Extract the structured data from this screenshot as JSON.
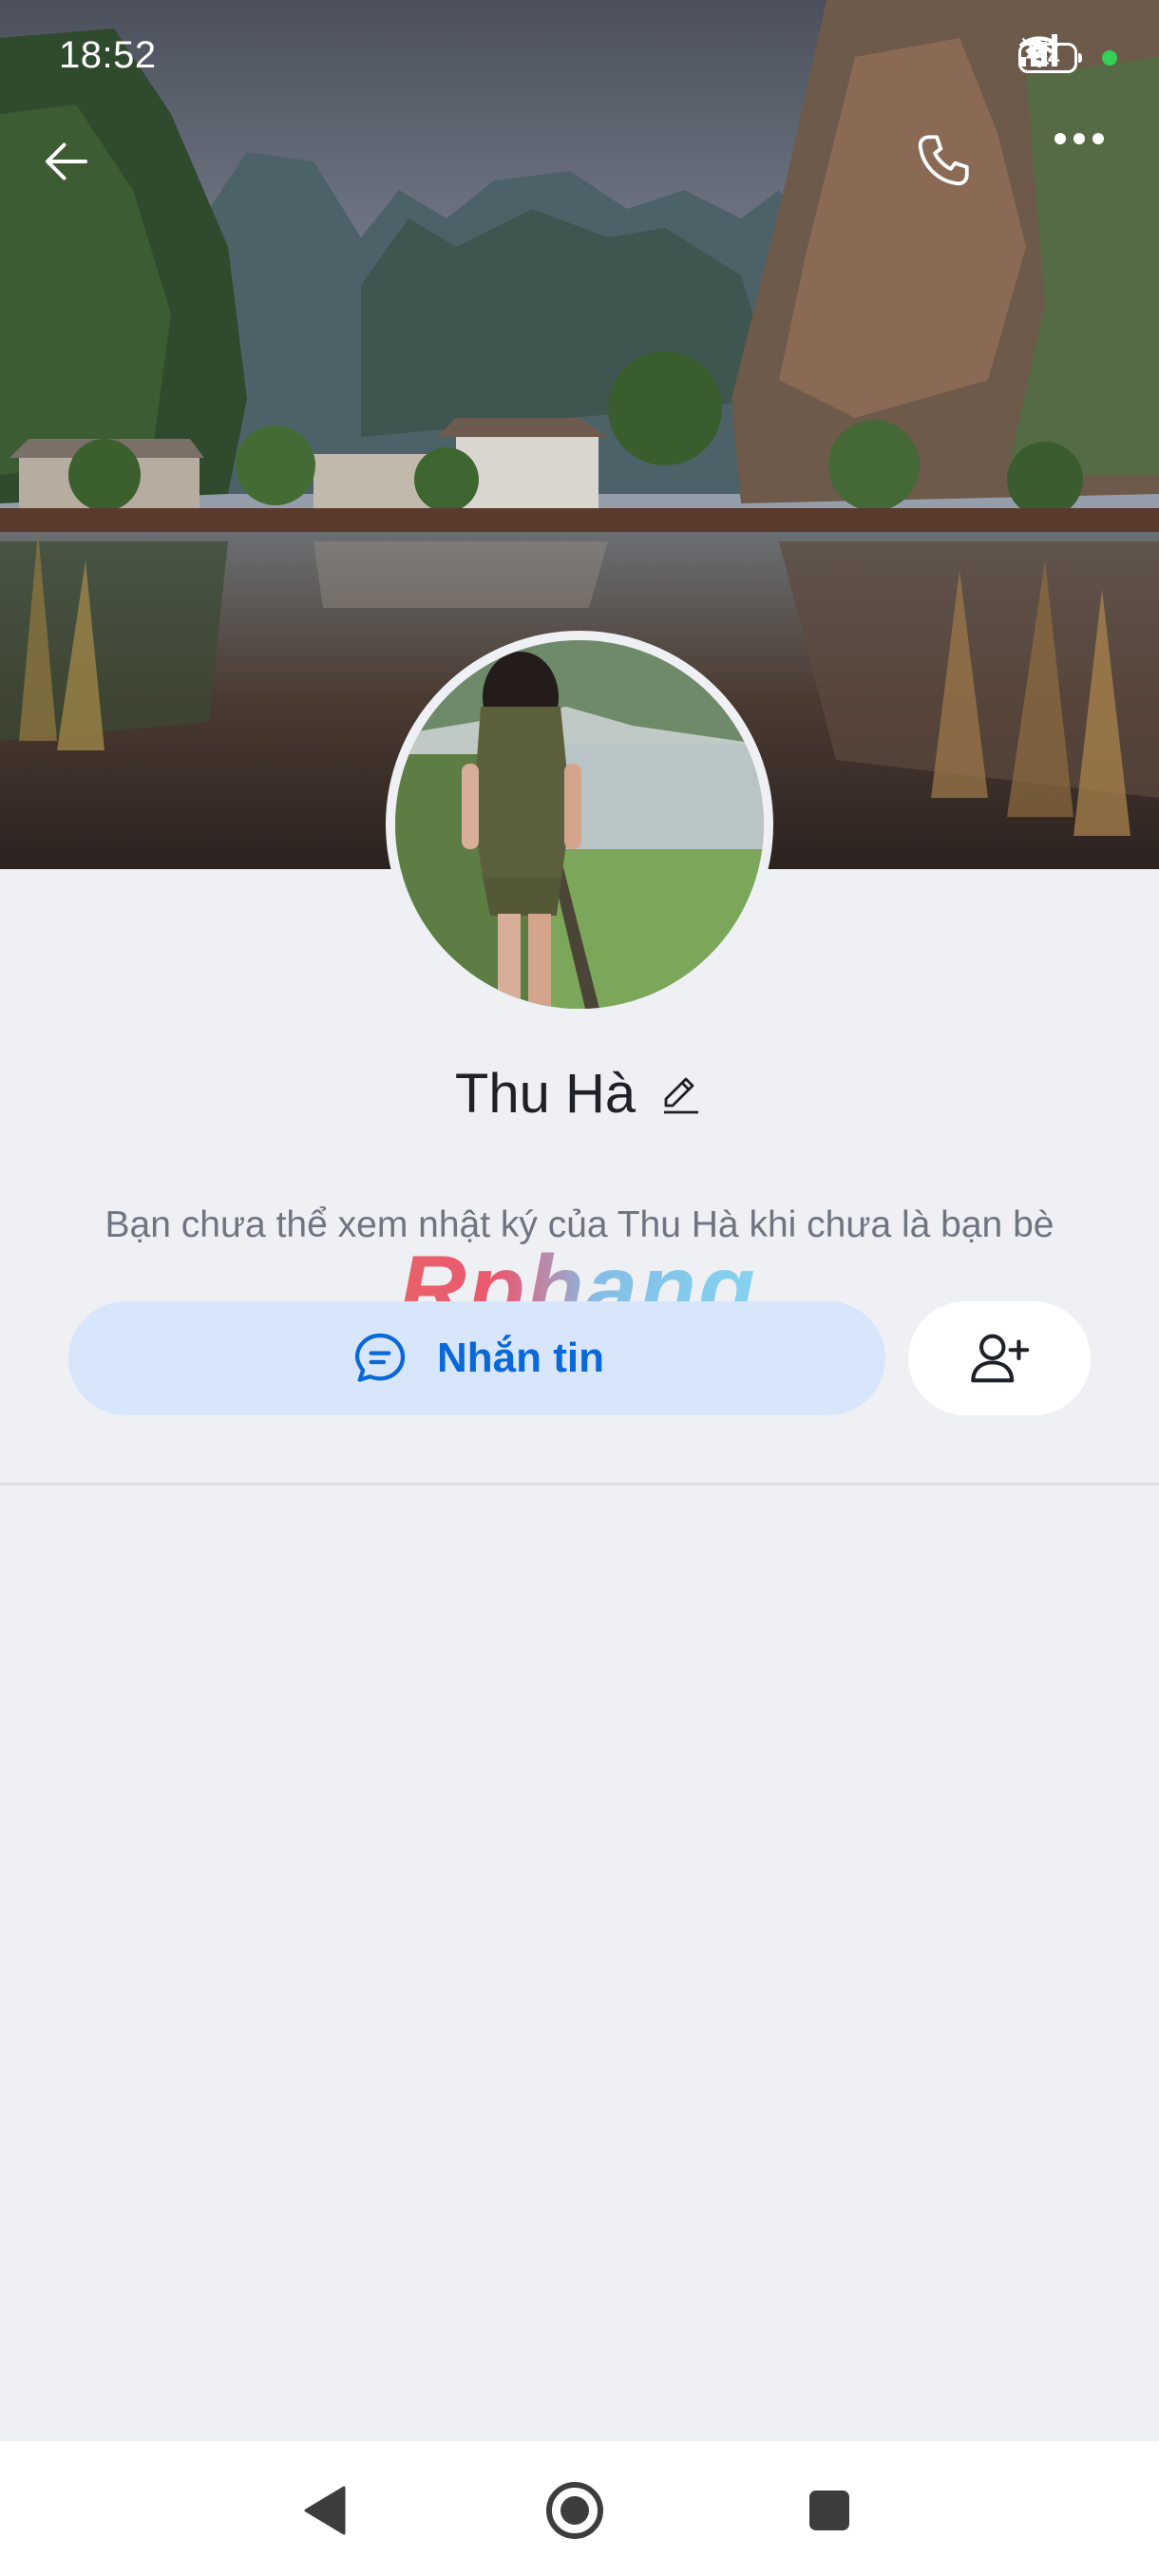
{
  "status_bar": {
    "time": "18:52",
    "battery_level": "34",
    "icons": [
      "bell-muted-icon",
      "signal-icon",
      "wifi-icon",
      "battery-icon",
      "green-dot-indicator"
    ]
  },
  "header": {
    "back_icon": "arrow-left-icon",
    "call_icon": "phone-icon",
    "more_icon": "more-horizontal-icon"
  },
  "profile": {
    "name": "Thu Hà",
    "edit_icon": "pencil-icon",
    "notice": "Bạn chưa thể xem nhật ký của Thu Hà khi chưa là bạn bè"
  },
  "watermark": {
    "text": "Rphang"
  },
  "actions": {
    "message_label": "Nhắn tin",
    "message_icon": "chat-bubble-icon",
    "add_friend_icon": "add-user-icon"
  },
  "nav_bar": {
    "items": [
      "back-triangle-icon",
      "home-circle-icon",
      "recents-square-icon"
    ]
  },
  "colors": {
    "accent": "#0a68d8",
    "message_button_bg": "#d8e6fb",
    "page_bg": "#eef0f4"
  }
}
